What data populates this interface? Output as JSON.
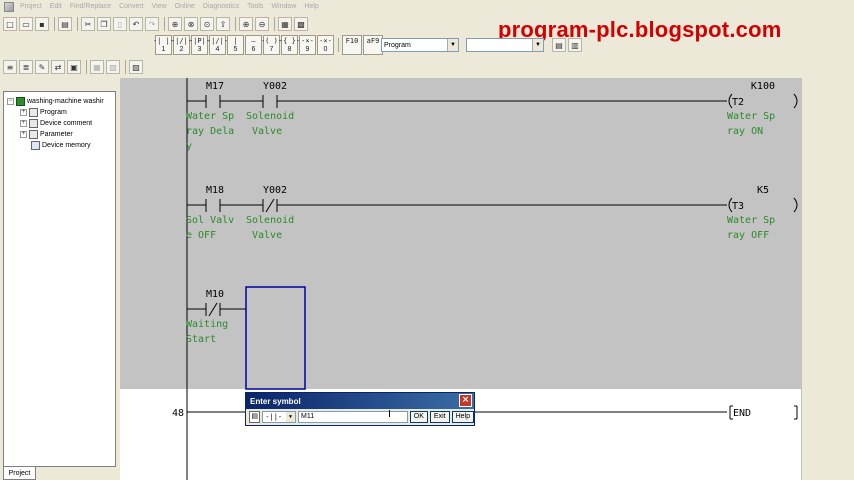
{
  "menu": [
    "Project",
    "Edit",
    "Find/Replace",
    "Convert",
    "View",
    "Online",
    "Diagnostics",
    "Tools",
    "Window",
    "Help"
  ],
  "watermark": "program-plc.blogspot.com",
  "ladder_keys": [
    {
      "sym": "-|  |-",
      "num": "1"
    },
    {
      "sym": "-|/|-",
      "num": "2"
    },
    {
      "sym": "-|P|-",
      "num": "3"
    },
    {
      "sym": "-|/|-",
      "num": "4"
    },
    {
      "sym": "|",
      "num": "5"
    },
    {
      "sym": "—",
      "num": "6"
    },
    {
      "sym": "-( )-",
      "num": "7"
    },
    {
      "sym": "-{ }-",
      "num": "8"
    },
    {
      "sym": "-×-",
      "num": "9"
    },
    {
      "sym": "-×-",
      "num": "0"
    },
    {
      "sym": "F10",
      "num": ""
    },
    {
      "sym": "aF9",
      "num": ""
    }
  ],
  "program_combo": "Program",
  "tree": {
    "root": "washing-machine washir",
    "items": [
      "Program",
      "Device comment",
      "Parameter",
      "Device memory"
    ]
  },
  "project_tab": "Project",
  "rungs": [
    {
      "contacts": [
        {
          "device": "M17",
          "type": "NO",
          "comment": [
            "Water Sp",
            "ray Dela",
            "y"
          ]
        },
        {
          "device": "Y002",
          "type": "NO",
          "comment": [
            "Solenoid",
            "Valve"
          ]
        }
      ],
      "coil": {
        "device": "T2",
        "setting": "K100",
        "comment": [
          "Water Sp",
          "ray ON"
        ]
      }
    },
    {
      "contacts": [
        {
          "device": "M18",
          "type": "NO",
          "comment": [
            "Sol Valv",
            "e OFF"
          ]
        },
        {
          "device": "Y002",
          "type": "NC",
          "comment": [
            "Solenoid",
            "Valve"
          ]
        }
      ],
      "coil": {
        "device": "T3",
        "setting": "K5",
        "comment": [
          "Water Sp",
          "ray OFF"
        ]
      }
    },
    {
      "contacts": [
        {
          "device": "M10",
          "type": "NC",
          "comment": [
            "Waiting",
            "Start"
          ]
        }
      ]
    }
  ],
  "end_step": "48",
  "end_label": "END",
  "dialog": {
    "title": "Enter symbol",
    "type_value": "-||-",
    "input_value": "M11",
    "ok": "OK",
    "exit": "Exit",
    "help": "Help"
  },
  "colors": {
    "comment": "#2a8a2a",
    "line": "#000000",
    "cursor": "#0000a0",
    "watermark": "#d40000"
  }
}
